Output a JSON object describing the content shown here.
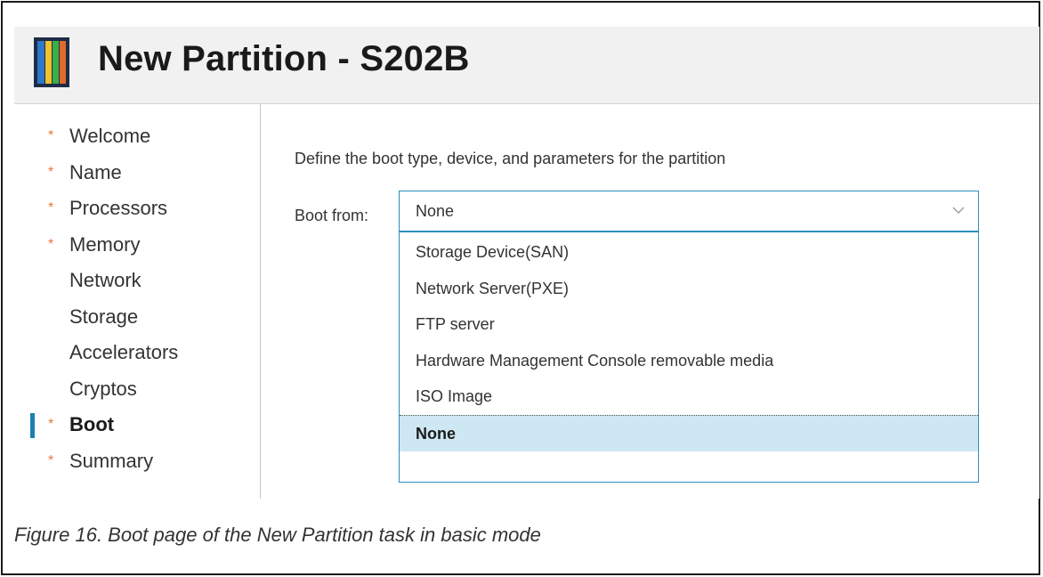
{
  "window": {
    "title": "New Partition - S202B"
  },
  "nav": {
    "items": [
      {
        "label": "Welcome",
        "required": true,
        "active": false
      },
      {
        "label": "Name",
        "required": true,
        "active": false
      },
      {
        "label": "Processors",
        "required": true,
        "active": false
      },
      {
        "label": "Memory",
        "required": true,
        "active": false
      },
      {
        "label": "Network",
        "required": false,
        "active": false
      },
      {
        "label": "Storage",
        "required": false,
        "active": false
      },
      {
        "label": "Accelerators",
        "required": false,
        "active": false
      },
      {
        "label": "Cryptos",
        "required": false,
        "active": false
      },
      {
        "label": "Boot",
        "required": true,
        "active": true
      },
      {
        "label": "Summary",
        "required": true,
        "active": false
      }
    ],
    "required_marker": "*"
  },
  "main": {
    "description": "Define the boot type, device, and parameters for the partition",
    "boot_from": {
      "label": "Boot from:",
      "value": "None",
      "options": [
        "Storage Device(SAN)",
        "Network Server(PXE)",
        "FTP server",
        "Hardware Management Console removable media",
        "ISO Image",
        "None"
      ],
      "selected_option": "None"
    }
  },
  "caption": "Figure 16. Boot page of the New Partition task in basic mode",
  "colors": {
    "accent": "#2a8fb8",
    "selected_bg": "#cde8f2",
    "required_marker": "#e8763a",
    "nav_marker": "#1f7fb0"
  }
}
